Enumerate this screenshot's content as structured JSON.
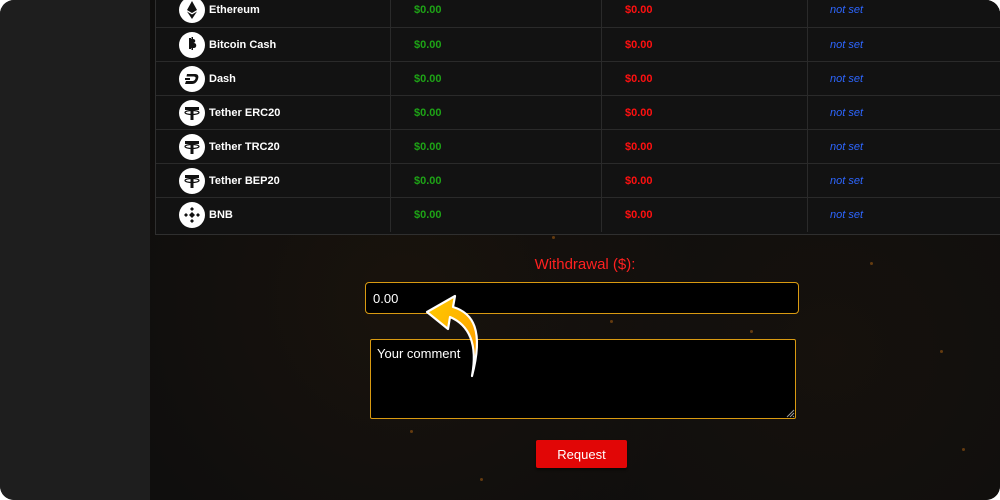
{
  "table": {
    "rows": [
      {
        "name": "Ethereum",
        "balance": "$0.00",
        "pending": "$0.00",
        "wallet": "not set",
        "icon": "ethereum-icon"
      },
      {
        "name": "Bitcoin Cash",
        "balance": "$0.00",
        "pending": "$0.00",
        "wallet": "not set",
        "icon": "bitcoin-cash-icon"
      },
      {
        "name": "Dash",
        "balance": "$0.00",
        "pending": "$0.00",
        "wallet": "not set",
        "icon": "dash-icon"
      },
      {
        "name": "Tether ERC20",
        "balance": "$0.00",
        "pending": "$0.00",
        "wallet": "not set",
        "icon": "tether-icon"
      },
      {
        "name": "Tether TRC20",
        "balance": "$0.00",
        "pending": "$0.00",
        "wallet": "not set",
        "icon": "tether-icon"
      },
      {
        "name": "Tether BEP20",
        "balance": "$0.00",
        "pending": "$0.00",
        "wallet": "not set",
        "icon": "tether-icon"
      },
      {
        "name": "BNB",
        "balance": "$0.00",
        "pending": "$0.00",
        "wallet": "not set",
        "icon": "bnb-icon"
      }
    ]
  },
  "withdrawal": {
    "label": "Withdrawal ($):",
    "amount_value": "0.00",
    "comment_placeholder": "Your comment",
    "request_label": "Request"
  },
  "colors": {
    "accent_red": "#e10606",
    "balance_green": "#1ea316",
    "wallet_blue": "#2d66ff",
    "border_gold": "#d99a11"
  }
}
